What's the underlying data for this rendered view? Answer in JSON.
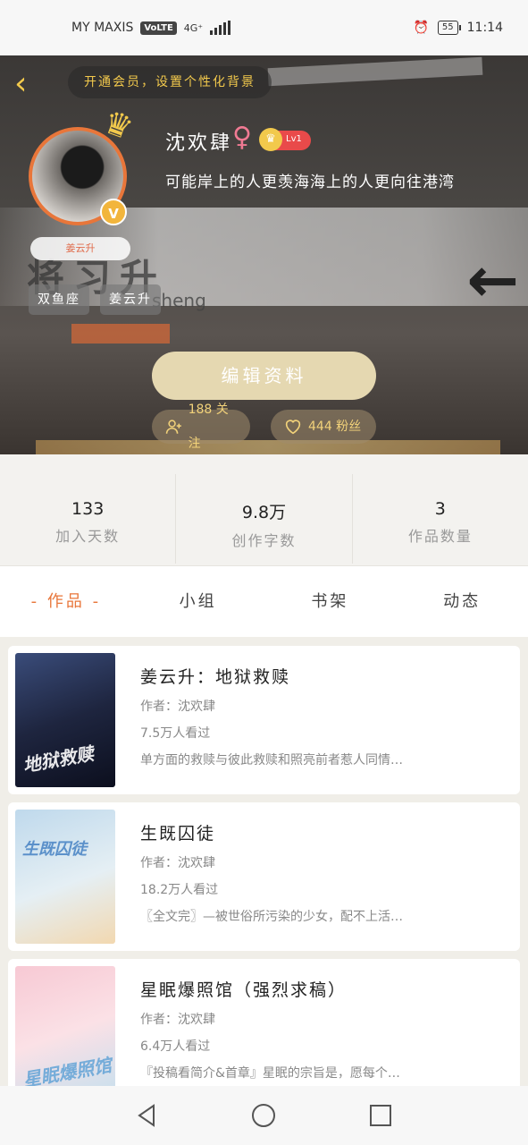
{
  "status": {
    "carrier": "MY MAXIS",
    "volte": "VoLTE",
    "network": "4G⁺",
    "battery": "55",
    "time": "11:14"
  },
  "header": {
    "vip_prompt": "开通会员，设置个性化背景",
    "username": "沈欢肆",
    "gender_symbol": "♀",
    "level": "Lv1",
    "bio": "可能岸上的人更羡海海上的人更向往港湾",
    "name_tag": "姜云升",
    "tags": [
      "双鱼座",
      "姜云升"
    ],
    "edit_label": "编辑资料",
    "following": "188 关注",
    "fans": "444 粉丝",
    "vip_badge": "V",
    "background_sign": "将习升",
    "background_sign_sub": "sheng"
  },
  "stats": [
    {
      "value": "133",
      "label": "加入天数"
    },
    {
      "value": "9.8万",
      "label": "创作字数"
    },
    {
      "value": "3",
      "label": "作品数量"
    }
  ],
  "tabs": [
    "- 作品 -",
    "小组",
    "书架",
    "动态"
  ],
  "works": [
    {
      "title": "姜云升：地狱救赎",
      "author": "作者：沈欢肆",
      "views": "7.5万人看过",
      "desc": "单方面的救赎与彼此救赎和照亮前者惹人同情…",
      "cover_text": "地狱救赎"
    },
    {
      "title": "生既囚徒",
      "author": "作者：沈欢肆",
      "views": "18.2万人看过",
      "desc": "〖全文完〗—被世俗所污染的少女，配不上活…",
      "cover_text": "生既囚徒"
    },
    {
      "title": "星眠爆照馆（强烈求稿）",
      "author": "作者：沈欢肆",
      "views": "6.4万人看过",
      "desc": "『投稿看简介&首章』星眠的宗旨是，愿每个…",
      "cover_text": "星眠爆照馆"
    }
  ]
}
